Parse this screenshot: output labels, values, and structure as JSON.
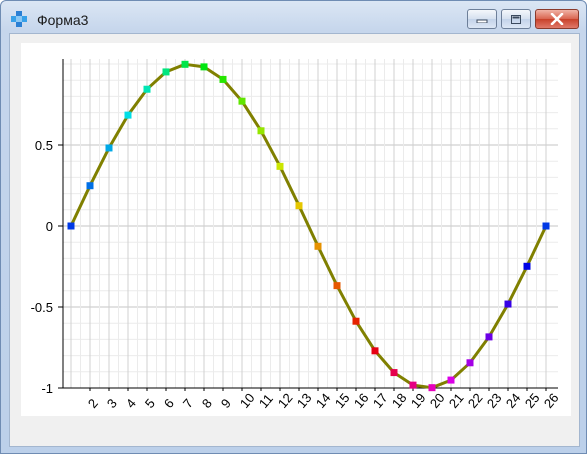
{
  "window": {
    "title": "Форма3",
    "icon": "app-grid-icon",
    "controls": [
      "minimize-icon",
      "maximize-icon",
      "close-icon"
    ]
  },
  "colors": {
    "line": "#808000",
    "grid": "#d0d0d0",
    "minor_grid": "#ebebeb",
    "axis": "#000000"
  },
  "chart_data": {
    "type": "line",
    "title": "",
    "xlabel": "",
    "ylabel": "",
    "x": [
      1,
      2,
      3,
      4,
      5,
      6,
      7,
      8,
      9,
      10,
      11,
      12,
      13,
      14,
      15,
      16,
      17,
      18,
      19,
      20,
      21,
      22,
      23,
      24,
      25,
      26
    ],
    "series": [
      {
        "values": [
          0,
          0.2487,
          0.4818,
          0.6845,
          0.8443,
          0.9511,
          0.998,
          0.9823,
          0.9048,
          0.7705,
          0.5878,
          0.3681,
          0.1253,
          -0.1253,
          -0.3681,
          -0.5878,
          -0.7705,
          -0.9048,
          -0.9823,
          -0.998,
          -0.9511,
          -0.8443,
          -0.6845,
          -0.4818,
          -0.2487,
          0
        ],
        "marker": "square",
        "marker_colors": "hue gradient: blue → cyan → green → yellow → orange → red → magenta → violet → blue"
      }
    ],
    "x_tick_labels": [
      "2",
      "3",
      "4",
      "5",
      "6",
      "7",
      "8",
      "9",
      "10",
      "11",
      "12",
      "13",
      "14",
      "15",
      "16",
      "17",
      "18",
      "19",
      "20",
      "21",
      "22",
      "23",
      "24",
      "25",
      "26"
    ],
    "y_tick_labels": [
      "0.5",
      "0",
      "-0.5",
      "-1"
    ],
    "y_ticks": [
      0.5,
      0,
      -0.5,
      -1
    ],
    "xlim": [
      1,
      26
    ],
    "ylim": [
      -1,
      1
    ],
    "grid": true
  }
}
